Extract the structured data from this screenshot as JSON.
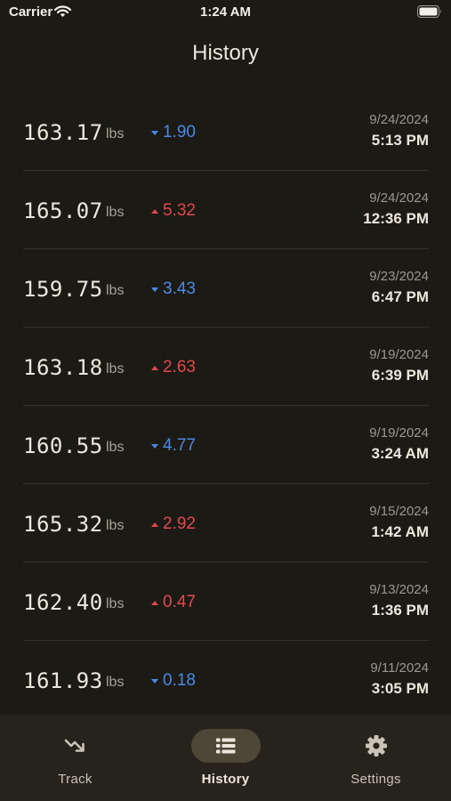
{
  "status_bar": {
    "carrier": "Carrier",
    "time": "1:24 AM"
  },
  "header": {
    "title": "History"
  },
  "entries": [
    {
      "weight": "163.17",
      "unit": "lbs",
      "direction": "down",
      "delta": "1.90",
      "date": "9/24/2024",
      "time": "5:13 PM"
    },
    {
      "weight": "165.07",
      "unit": "lbs",
      "direction": "up",
      "delta": "5.32",
      "date": "9/24/2024",
      "time": "12:36 PM"
    },
    {
      "weight": "159.75",
      "unit": "lbs",
      "direction": "down",
      "delta": "3.43",
      "date": "9/23/2024",
      "time": "6:47 PM"
    },
    {
      "weight": "163.18",
      "unit": "lbs",
      "direction": "up",
      "delta": "2.63",
      "date": "9/19/2024",
      "time": "6:39 PM"
    },
    {
      "weight": "160.55",
      "unit": "lbs",
      "direction": "down",
      "delta": "4.77",
      "date": "9/19/2024",
      "time": "3:24 AM"
    },
    {
      "weight": "165.32",
      "unit": "lbs",
      "direction": "up",
      "delta": "2.92",
      "date": "9/15/2024",
      "time": "1:42 AM"
    },
    {
      "weight": "162.40",
      "unit": "lbs",
      "direction": "up",
      "delta": "0.47",
      "date": "9/13/2024",
      "time": "1:36 PM"
    },
    {
      "weight": "161.93",
      "unit": "lbs",
      "direction": "down",
      "delta": "0.18",
      "date": "9/11/2024",
      "time": "3:05 PM"
    }
  ],
  "tab_bar": {
    "tabs": [
      {
        "label": "Track",
        "icon": "trend-down-icon",
        "active": false
      },
      {
        "label": "History",
        "icon": "list-icon",
        "active": true
      },
      {
        "label": "Settings",
        "icon": "gear-icon",
        "active": false
      }
    ]
  },
  "colors": {
    "background": "#1c1a15",
    "tab_bar": "#26231c",
    "active_tab_pill": "#4c4737",
    "decrease": "#4a8ae6",
    "increase": "#e0484d"
  }
}
